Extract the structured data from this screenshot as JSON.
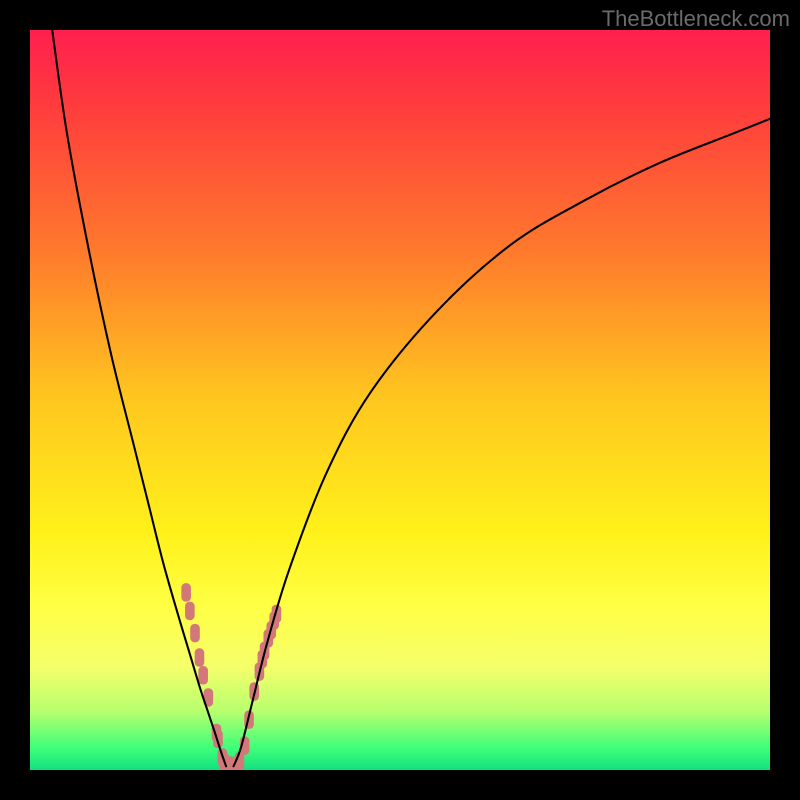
{
  "watermark": "TheBottleneck.com",
  "chart_data": {
    "type": "line",
    "title": "",
    "xlabel": "",
    "ylabel": "",
    "xlim": [
      0,
      100
    ],
    "ylim": [
      0,
      100
    ],
    "gradient_stops": [
      {
        "offset": 0.0,
        "color": "#ff1f4e"
      },
      {
        "offset": 0.1,
        "color": "#ff3b3e"
      },
      {
        "offset": 0.3,
        "color": "#ff7a2c"
      },
      {
        "offset": 0.5,
        "color": "#ffc71f"
      },
      {
        "offset": 0.68,
        "color": "#fff11a"
      },
      {
        "offset": 0.78,
        "color": "#ffff45"
      },
      {
        "offset": 0.86,
        "color": "#f5ff6a"
      },
      {
        "offset": 0.92,
        "color": "#b8ff6e"
      },
      {
        "offset": 0.97,
        "color": "#3fff7a"
      },
      {
        "offset": 1.0,
        "color": "#13e07e"
      }
    ],
    "series": [
      {
        "name": "left_branch",
        "x": [
          3.0,
          5.0,
          8.0,
          11.0,
          14.0,
          16.0,
          18.0,
          20.0,
          21.5,
          23.0,
          24.0,
          25.0,
          25.8,
          26.5
        ],
        "y": [
          100.0,
          86.0,
          70.0,
          56.0,
          44.0,
          36.0,
          28.0,
          21.0,
          16.0,
          11.0,
          8.0,
          5.0,
          2.5,
          0.5
        ]
      },
      {
        "name": "right_branch",
        "x": [
          27.5,
          28.5,
          30.0,
          32.0,
          35.0,
          40.0,
          46.0,
          55.0,
          65.0,
          75.0,
          85.0,
          95.0,
          100.0
        ],
        "y": [
          0.5,
          3.0,
          9.0,
          17.0,
          27.0,
          40.0,
          51.0,
          62.0,
          71.0,
          77.0,
          82.0,
          86.0,
          88.0
        ]
      }
    ],
    "markers": {
      "name": "sample_points",
      "color": "#d37878",
      "points": [
        {
          "x": 21.1,
          "y": 24.0
        },
        {
          "x": 21.6,
          "y": 21.5
        },
        {
          "x": 22.3,
          "y": 18.5
        },
        {
          "x": 22.9,
          "y": 15.2
        },
        {
          "x": 23.4,
          "y": 12.8
        },
        {
          "x": 24.1,
          "y": 9.8
        },
        {
          "x": 25.2,
          "y": 5.0
        },
        {
          "x": 25.4,
          "y": 4.2
        },
        {
          "x": 26.0,
          "y": 1.7
        },
        {
          "x": 26.3,
          "y": 1.0
        },
        {
          "x": 27.0,
          "y": 0.6
        },
        {
          "x": 27.8,
          "y": 0.6
        },
        {
          "x": 28.3,
          "y": 1.2
        },
        {
          "x": 29.0,
          "y": 3.3
        },
        {
          "x": 29.6,
          "y": 6.8
        },
        {
          "x": 30.3,
          "y": 10.6
        },
        {
          "x": 31.0,
          "y": 13.3
        },
        {
          "x": 31.4,
          "y": 15.0
        },
        {
          "x": 31.7,
          "y": 16.1
        },
        {
          "x": 32.2,
          "y": 17.8
        },
        {
          "x": 32.6,
          "y": 18.9
        },
        {
          "x": 33.0,
          "y": 20.2
        },
        {
          "x": 33.3,
          "y": 21.1
        }
      ]
    }
  }
}
